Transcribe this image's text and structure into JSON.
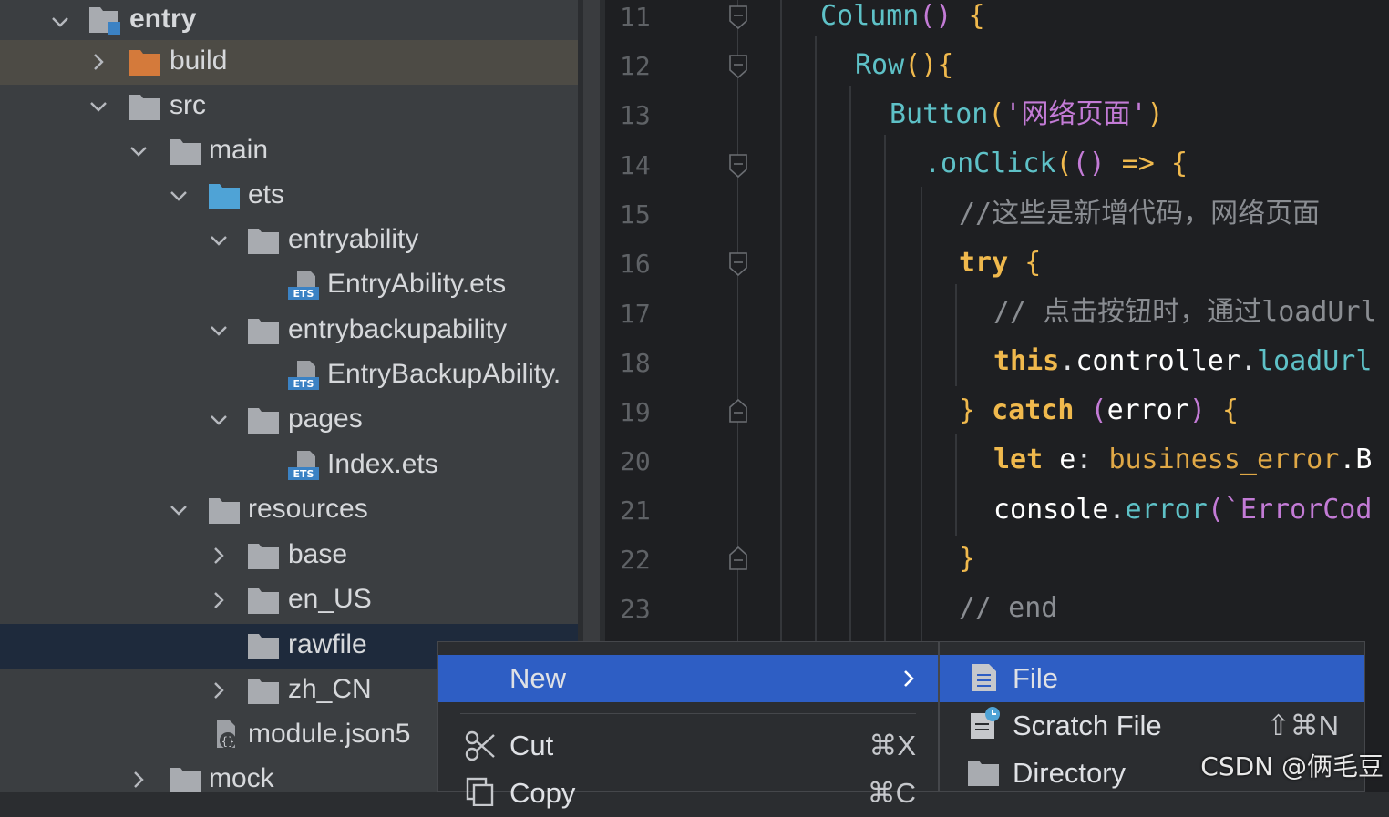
{
  "tree": {
    "items": [
      {
        "label": "entry"
      },
      {
        "label": "build"
      },
      {
        "label": "src"
      },
      {
        "label": "main"
      },
      {
        "label": "ets"
      },
      {
        "label": "entryability"
      },
      {
        "label": "EntryAbility.ets"
      },
      {
        "label": "entrybackupability"
      },
      {
        "label": "EntryBackupAbility."
      },
      {
        "label": "pages"
      },
      {
        "label": "Index.ets"
      },
      {
        "label": "resources"
      },
      {
        "label": "base"
      },
      {
        "label": "en_US"
      },
      {
        "label": "rawfile"
      },
      {
        "label": "zh_CN"
      },
      {
        "label": "module.json5"
      },
      {
        "label": "mock"
      }
    ],
    "file_badge": "ETS",
    "json_badge": "{}"
  },
  "editor": {
    "line_numbers": [
      "11",
      "12",
      "13",
      "14",
      "15",
      "16",
      "17",
      "18",
      "19",
      "20",
      "21",
      "22",
      "23"
    ],
    "code": {
      "l11": [
        "Column",
        "()",
        " {"
      ],
      "l12": [
        "Row",
        "(){"
      ],
      "l13": [
        "Button",
        "(",
        "'网络页面'",
        ")"
      ],
      "l14": [
        ".onClick",
        "(",
        "()",
        " => ",
        "{"
      ],
      "l15": [
        "//这些是新增代码，网络页面"
      ],
      "l16": [
        "try",
        " {"
      ],
      "l17": [
        "// 点击按钮时，通过loadUrl"
      ],
      "l18": [
        "this",
        ".",
        "controller",
        ".",
        "loadUrl"
      ],
      "l19": [
        "}",
        " catch ",
        "(",
        "error",
        ")",
        " {"
      ],
      "l20": [
        "let",
        " e",
        ": ",
        "business_error",
        ".B"
      ],
      "l21": [
        "console",
        ".",
        "error",
        "(",
        "`ErrorCod"
      ],
      "l22": [
        "}"
      ],
      "l23": [
        "// end"
      ]
    }
  },
  "context_menu": {
    "items": [
      {
        "label": "New"
      },
      {
        "label": "Cut",
        "shortcut": "⌘X"
      },
      {
        "label": "Copy",
        "shortcut": "⌘C"
      }
    ]
  },
  "new_submenu": {
    "items": [
      {
        "label": "File"
      },
      {
        "label": "Scratch File",
        "shortcut": "⇧⌘N"
      },
      {
        "label": "Directory"
      }
    ]
  },
  "watermark": "CSDN @俩毛豆",
  "colors": {
    "accent": "#2e5ec4",
    "keyword": "#f0b94d",
    "function": "#5ec1c7",
    "string": "#c37bd6",
    "comment": "#8a8d92",
    "folder_build": "#d47a3b",
    "folder_ets": "#4fa3d6"
  }
}
